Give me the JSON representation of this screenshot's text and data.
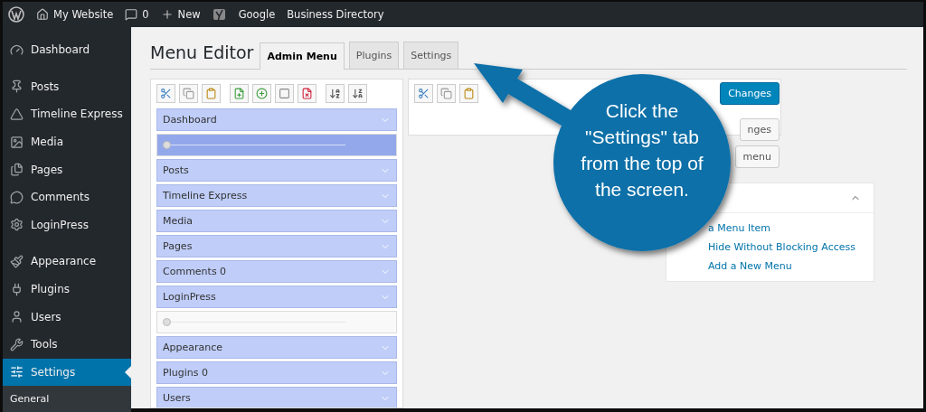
{
  "admin_bar": {
    "items": [
      {
        "kind": "home",
        "label": "My Website"
      },
      {
        "kind": "comments",
        "label": "0"
      },
      {
        "kind": "new",
        "label": "New"
      },
      {
        "kind": "seo"
      },
      {
        "kind": "text",
        "label": "Google"
      },
      {
        "kind": "text",
        "label": "Business Directory"
      }
    ]
  },
  "sidebar": {
    "groups": [
      [
        {
          "label": "Dashboard",
          "selected": false
        }
      ],
      [
        {
          "label": "Posts",
          "selected": false
        },
        {
          "label": "Timeline Express",
          "selected": false
        },
        {
          "label": "Media",
          "selected": false
        },
        {
          "label": "Pages",
          "selected": false
        },
        {
          "label": "Comments",
          "selected": false
        },
        {
          "label": "LoginPress",
          "selected": false
        }
      ],
      [
        {
          "label": "Appearance",
          "selected": false
        },
        {
          "label": "Plugins",
          "selected": false
        },
        {
          "label": "Users",
          "selected": false
        },
        {
          "label": "Tools",
          "selected": false
        },
        {
          "label": "Settings",
          "selected": true
        }
      ]
    ],
    "submenu": [
      "General"
    ]
  },
  "page": {
    "title": "Menu Editor",
    "tabs": [
      {
        "label": "Admin Menu",
        "selected": true
      },
      {
        "label": "Plugins",
        "selected": false
      },
      {
        "label": "Settings",
        "selected": false
      }
    ]
  },
  "menu_list": {
    "items": [
      {
        "kind": "item",
        "label": "Dashboard",
        "selected": false
      },
      {
        "kind": "separator",
        "selected": true
      },
      {
        "kind": "item",
        "label": "Posts",
        "selected": false
      },
      {
        "kind": "item",
        "label": "Timeline Express",
        "selected": false
      },
      {
        "kind": "item",
        "label": "Media",
        "selected": false
      },
      {
        "kind": "item",
        "label": "Pages",
        "selected": false
      },
      {
        "kind": "item",
        "label": "Comments 0",
        "selected": false
      },
      {
        "kind": "item",
        "label": "LoginPress",
        "selected": false
      },
      {
        "kind": "separator",
        "selected": false
      },
      {
        "kind": "item",
        "label": "Appearance",
        "selected": false
      },
      {
        "kind": "item",
        "label": "Plugins 0",
        "selected": false
      },
      {
        "kind": "item",
        "label": "Users",
        "selected": false
      }
    ]
  },
  "actions": [
    {
      "label": "Changes",
      "primary": true
    },
    {
      "label": "nges",
      "primary": false
    },
    {
      "label": "menu",
      "primary": false
    }
  ],
  "how_to": {
    "links": [
      "a Menu Item",
      "Hide Without Blocking Access",
      "Add a New Menu"
    ]
  },
  "callout": {
    "text": "Click the \"Settings\" tab from the top of the screen."
  }
}
